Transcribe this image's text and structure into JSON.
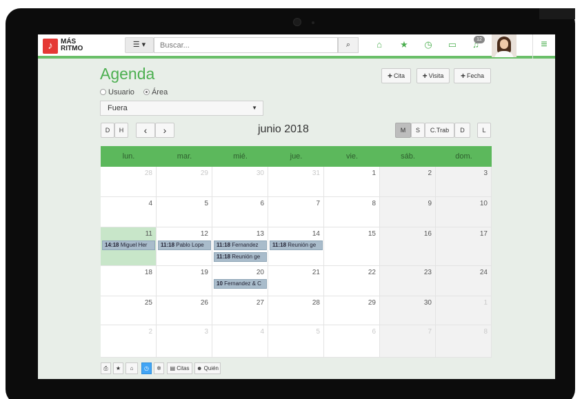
{
  "brand": {
    "line1": "MÁS",
    "line2": "RITMO"
  },
  "header": {
    "view_toggle_label": "☰ ▾",
    "search_placeholder": "Buscar...",
    "notification_count": "12"
  },
  "page": {
    "title": "Agenda",
    "filter_options": [
      {
        "label": "Usuario",
        "checked": false
      },
      {
        "label": "Área",
        "checked": true
      }
    ],
    "area_select_value": "Fuera"
  },
  "actions": {
    "cita": "Cita",
    "visita": "Visita",
    "fecha": "Fecha"
  },
  "toolbar": {
    "left": [
      "D",
      "H"
    ],
    "prev": "‹",
    "next": "›",
    "month_title": "junio 2018",
    "views": [
      "M",
      "S",
      "C.Trab",
      "D"
    ],
    "active_view": "M",
    "extra": "L"
  },
  "calendar": {
    "weekdays": [
      "lun.",
      "mar.",
      "mié.",
      "jue.",
      "vie.",
      "sáb.",
      "dom."
    ],
    "weeks": [
      [
        {
          "d": "28",
          "o": true
        },
        {
          "d": "29",
          "o": true
        },
        {
          "d": "30",
          "o": true
        },
        {
          "d": "31",
          "o": true
        },
        {
          "d": "1"
        },
        {
          "d": "2"
        },
        {
          "d": "3"
        }
      ],
      [
        {
          "d": "4"
        },
        {
          "d": "5"
        },
        {
          "d": "6"
        },
        {
          "d": "7"
        },
        {
          "d": "8"
        },
        {
          "d": "9"
        },
        {
          "d": "10"
        }
      ],
      [
        {
          "d": "11",
          "today": true,
          "events": [
            {
              "time": "14:18",
              "text": "Miguel Her"
            }
          ]
        },
        {
          "d": "12",
          "events": [
            {
              "time": "11:18",
              "text": "Pablo Lope"
            }
          ]
        },
        {
          "d": "13",
          "events": [
            {
              "time": "11:18",
              "text": "Fernandez"
            },
            {
              "time": "11:18",
              "text": "Reunión ge"
            }
          ]
        },
        {
          "d": "14",
          "events": [
            {
              "time": "11:18",
              "text": "Reunión ge"
            }
          ]
        },
        {
          "d": "15"
        },
        {
          "d": "16"
        },
        {
          "d": "17"
        }
      ],
      [
        {
          "d": "18"
        },
        {
          "d": "19"
        },
        {
          "d": "20",
          "events": [
            {
              "time": "10",
              "text": "Fernandez & C"
            }
          ]
        },
        {
          "d": "21"
        },
        {
          "d": "22"
        },
        {
          "d": "23"
        },
        {
          "d": "24"
        }
      ],
      [
        {
          "d": "25"
        },
        {
          "d": "26"
        },
        {
          "d": "27"
        },
        {
          "d": "28"
        },
        {
          "d": "29"
        },
        {
          "d": "30"
        },
        {
          "d": "1",
          "o": true
        }
      ],
      [
        {
          "d": "2",
          "o": true
        },
        {
          "d": "3",
          "o": true
        },
        {
          "d": "4",
          "o": true
        },
        {
          "d": "5",
          "o": true
        },
        {
          "d": "6",
          "o": true
        },
        {
          "d": "7",
          "o": true
        },
        {
          "d": "8",
          "o": true
        }
      ]
    ]
  },
  "footer": {
    "citas": "Citas",
    "quien": "Quién"
  },
  "colors": {
    "accent": "#4caf50",
    "header_bar": "#5cb85c",
    "event": "#a9bccb",
    "today": "#c8e6c9",
    "logo": "#e53935"
  }
}
